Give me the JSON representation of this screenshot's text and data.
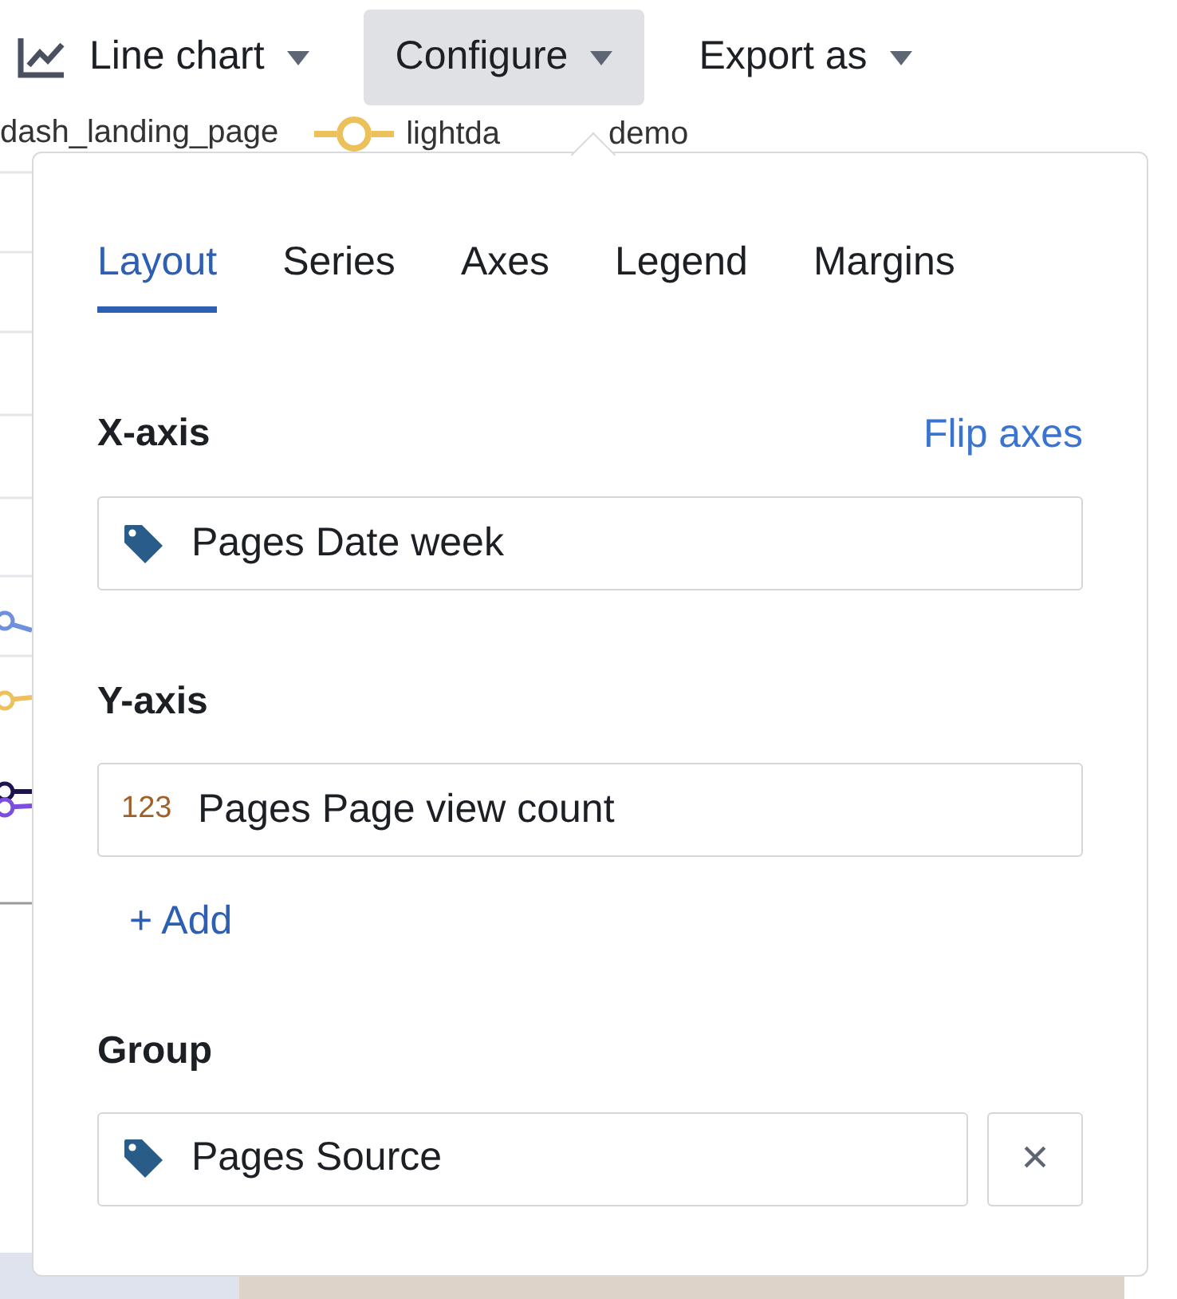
{
  "toolbar": [
    {
      "kind": "chart-type",
      "label": "Line chart",
      "selected": false
    },
    {
      "kind": "menu",
      "label": "Configure",
      "selected": true
    },
    {
      "kind": "menu",
      "label": "Export as",
      "selected": false
    }
  ],
  "legend": [
    {
      "label": "dash_landing_page"
    },
    {
      "label": "lightda",
      "label_end": "demo",
      "color": "#ecc05a"
    }
  ],
  "popover": {
    "tabs": [
      {
        "label": "Layout",
        "selected": true
      },
      {
        "label": "Series",
        "selected": false
      },
      {
        "label": "Axes",
        "selected": false
      },
      {
        "label": "Legend",
        "selected": false
      },
      {
        "label": "Margins",
        "selected": false
      }
    ],
    "x_axis": {
      "label": "X-axis",
      "action": "Flip axes",
      "field": {
        "kind": "dimension",
        "value": "Pages Date week"
      }
    },
    "y_axis": {
      "label": "Y-axis",
      "fields": [
        {
          "kind": "metric",
          "badge": "123",
          "value": "Pages Page view count"
        }
      ],
      "add": "+ Add"
    },
    "group": {
      "label": "Group",
      "field": {
        "kind": "dimension",
        "value": "Pages Source"
      },
      "remove": "×"
    }
  }
}
